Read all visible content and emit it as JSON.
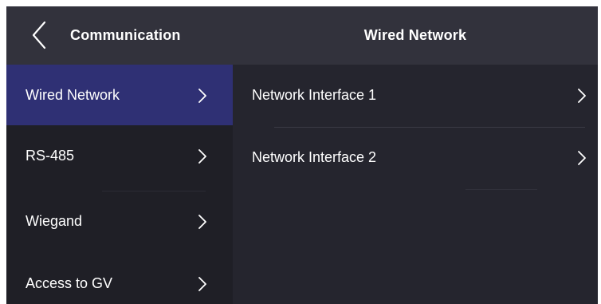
{
  "header": {
    "back_icon": "chevron-left-icon",
    "left_title": "Communication",
    "main_title": "Wired Network"
  },
  "sidebar": {
    "items": [
      {
        "label": "Wired Network",
        "active": true,
        "icon": "chevron-right-icon"
      },
      {
        "label": "RS-485",
        "active": false,
        "icon": "chevron-right-icon"
      },
      {
        "label": "Wiegand",
        "active": false,
        "icon": "chevron-right-icon"
      },
      {
        "label": "Access to GV",
        "active": false,
        "icon": "chevron-right-icon"
      }
    ]
  },
  "main": {
    "rows": [
      {
        "label": "Network Interface 1",
        "icon": "chevron-right-icon"
      },
      {
        "label": "Network Interface 2",
        "icon": "chevron-right-icon"
      }
    ]
  },
  "colors": {
    "header_bg": "#32323c",
    "sidebar_bg": "#1f1f26",
    "active_bg": "#2f3074",
    "content_bg": "#25252e",
    "text": "#ffffff"
  }
}
